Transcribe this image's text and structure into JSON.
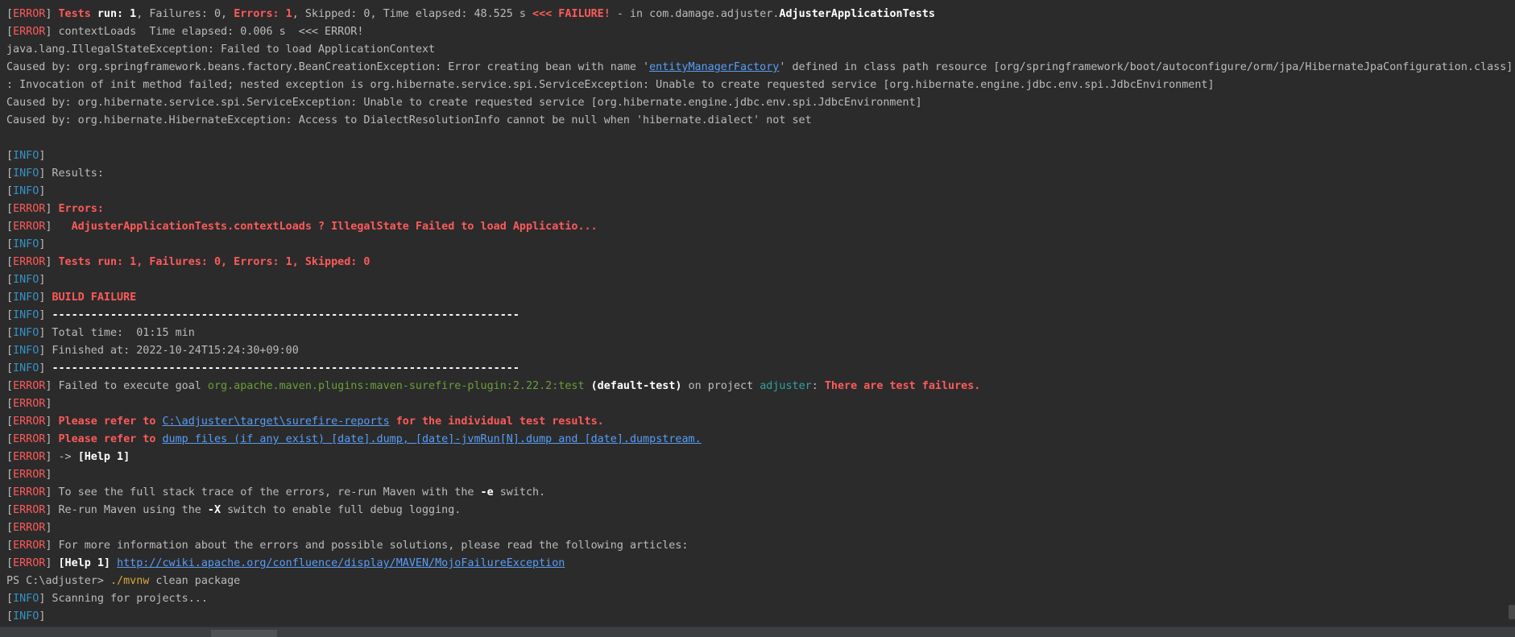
{
  "terminal": {
    "lines": [
      {
        "segments": [
          {
            "t": "[",
            "c": "default"
          },
          {
            "t": "ERROR",
            "c": "error"
          },
          {
            "t": "] ",
            "c": "default"
          },
          {
            "t": "Tests ",
            "c": "error-b"
          },
          {
            "t": "run: 1",
            "c": "white-b"
          },
          {
            "t": ", Failures: 0, ",
            "c": "default"
          },
          {
            "t": "Errors: 1",
            "c": "error-b"
          },
          {
            "t": ", Skipped: 0, Time elapsed: 48.525 s ",
            "c": "default"
          },
          {
            "t": "<<< FAILURE!",
            "c": "error-b"
          },
          {
            "t": " - in com.damage.adjuster.",
            "c": "default"
          },
          {
            "t": "AdjusterApplicationTests",
            "c": "white-b"
          }
        ]
      },
      {
        "segments": [
          {
            "t": "[",
            "c": "default"
          },
          {
            "t": "ERROR",
            "c": "error"
          },
          {
            "t": "] contextLoads  Time elapsed: 0.006 s  <<< ERROR!",
            "c": "default"
          }
        ]
      },
      {
        "segments": [
          {
            "t": "java.lang.IllegalStateException: Failed to load ApplicationContext",
            "c": "default"
          }
        ]
      },
      {
        "segments": [
          {
            "t": "Caused by: org.springframework.beans.factory.BeanCreationException: Error creating bean with name '",
            "c": "default"
          },
          {
            "t": "entityManagerFactory",
            "c": "link"
          },
          {
            "t": "' defined in class path resource [org/springframework/boot/autoconfigure/orm/jpa/HibernateJpaConfiguration.class]",
            "c": "default"
          }
        ]
      },
      {
        "segments": [
          {
            "t": ": Invocation of init method failed; nested exception is org.hibernate.service.spi.ServiceException: Unable to create requested service [org.hibernate.engine.jdbc.env.spi.JdbcEnvironment]",
            "c": "default"
          }
        ]
      },
      {
        "segments": [
          {
            "t": "Caused by: org.hibernate.service.spi.ServiceException: Unable to create requested service [org.hibernate.engine.jdbc.env.spi.JdbcEnvironment]",
            "c": "default"
          }
        ]
      },
      {
        "segments": [
          {
            "t": "Caused by: org.hibernate.HibernateException: Access to DialectResolutionInfo cannot be null when 'hibernate.dialect' not set",
            "c": "default"
          }
        ]
      },
      {
        "segments": []
      },
      {
        "segments": [
          {
            "t": "[",
            "c": "default"
          },
          {
            "t": "INFO",
            "c": "info"
          },
          {
            "t": "]",
            "c": "default"
          }
        ]
      },
      {
        "segments": [
          {
            "t": "[",
            "c": "default"
          },
          {
            "t": "INFO",
            "c": "info"
          },
          {
            "t": "] Results:",
            "c": "default"
          }
        ]
      },
      {
        "segments": [
          {
            "t": "[",
            "c": "default"
          },
          {
            "t": "INFO",
            "c": "info"
          },
          {
            "t": "]",
            "c": "default"
          }
        ]
      },
      {
        "segments": [
          {
            "t": "[",
            "c": "default"
          },
          {
            "t": "ERROR",
            "c": "error"
          },
          {
            "t": "] ",
            "c": "default"
          },
          {
            "t": "Errors:",
            "c": "error-b"
          }
        ]
      },
      {
        "segments": [
          {
            "t": "[",
            "c": "default"
          },
          {
            "t": "ERROR",
            "c": "error"
          },
          {
            "t": "]   ",
            "c": "default"
          },
          {
            "t": "AdjusterApplicationTests.contextLoads ? IllegalState Failed to load Applicatio...",
            "c": "error-b"
          }
        ]
      },
      {
        "segments": [
          {
            "t": "[",
            "c": "default"
          },
          {
            "t": "INFO",
            "c": "info"
          },
          {
            "t": "]",
            "c": "default"
          }
        ]
      },
      {
        "segments": [
          {
            "t": "[",
            "c": "default"
          },
          {
            "t": "ERROR",
            "c": "error"
          },
          {
            "t": "] ",
            "c": "default"
          },
          {
            "t": "Tests run: 1, Failures: 0, Errors: 1, Skipped: 0",
            "c": "error-b"
          }
        ]
      },
      {
        "segments": [
          {
            "t": "[",
            "c": "default"
          },
          {
            "t": "INFO",
            "c": "info"
          },
          {
            "t": "]",
            "c": "default"
          }
        ]
      },
      {
        "segments": [
          {
            "t": "[",
            "c": "default"
          },
          {
            "t": "INFO",
            "c": "info"
          },
          {
            "t": "] ",
            "c": "default"
          },
          {
            "t": "BUILD FAILURE",
            "c": "error-b"
          }
        ]
      },
      {
        "segments": [
          {
            "t": "[",
            "c": "default"
          },
          {
            "t": "INFO",
            "c": "info"
          },
          {
            "t": "] ",
            "c": "default"
          },
          {
            "t": "------------------------------------------------------------------------",
            "c": "white-b"
          }
        ]
      },
      {
        "segments": [
          {
            "t": "[",
            "c": "default"
          },
          {
            "t": "INFO",
            "c": "info"
          },
          {
            "t": "] Total time:  01:15 min",
            "c": "default"
          }
        ]
      },
      {
        "segments": [
          {
            "t": "[",
            "c": "default"
          },
          {
            "t": "INFO",
            "c": "info"
          },
          {
            "t": "] Finished at: 2022-10-24T15:24:30+09:00",
            "c": "default"
          }
        ]
      },
      {
        "segments": [
          {
            "t": "[",
            "c": "default"
          },
          {
            "t": "INFO",
            "c": "info"
          },
          {
            "t": "] ",
            "c": "default"
          },
          {
            "t": "------------------------------------------------------------------------",
            "c": "white-b"
          }
        ]
      },
      {
        "segments": [
          {
            "t": "[",
            "c": "default"
          },
          {
            "t": "ERROR",
            "c": "error"
          },
          {
            "t": "] Failed to execute goal ",
            "c": "default"
          },
          {
            "t": "org.apache.maven.plugins:maven-surefire-plugin:2.22.2:test",
            "c": "green"
          },
          {
            "t": " ",
            "c": "default"
          },
          {
            "t": "(default-test)",
            "c": "white-b"
          },
          {
            "t": " on project ",
            "c": "default"
          },
          {
            "t": "adjuster",
            "c": "cyan"
          },
          {
            "t": ": ",
            "c": "default"
          },
          {
            "t": "There are test failures.",
            "c": "error-b"
          }
        ]
      },
      {
        "segments": [
          {
            "t": "[",
            "c": "default"
          },
          {
            "t": "ERROR",
            "c": "error"
          },
          {
            "t": "]",
            "c": "default"
          }
        ]
      },
      {
        "segments": [
          {
            "t": "[",
            "c": "default"
          },
          {
            "t": "ERROR",
            "c": "error"
          },
          {
            "t": "] ",
            "c": "default"
          },
          {
            "t": "Please refer to ",
            "c": "error-b"
          },
          {
            "t": "C:\\adjuster\\target\\surefire-reports",
            "c": "link"
          },
          {
            "t": " for the individual test results.",
            "c": "error-b"
          }
        ]
      },
      {
        "segments": [
          {
            "t": "[",
            "c": "default"
          },
          {
            "t": "ERROR",
            "c": "error"
          },
          {
            "t": "] ",
            "c": "default"
          },
          {
            "t": "Please refer to ",
            "c": "error-b"
          },
          {
            "t": "dump files (if any exist) [date].dump, [date]-jvmRun[N].dump and [date].dumpstream.",
            "c": "link"
          }
        ]
      },
      {
        "segments": [
          {
            "t": "[",
            "c": "default"
          },
          {
            "t": "ERROR",
            "c": "error"
          },
          {
            "t": "] -> ",
            "c": "default"
          },
          {
            "t": "[Help 1]",
            "c": "white-b"
          }
        ]
      },
      {
        "segments": [
          {
            "t": "[",
            "c": "default"
          },
          {
            "t": "ERROR",
            "c": "error"
          },
          {
            "t": "]",
            "c": "default"
          }
        ]
      },
      {
        "segments": [
          {
            "t": "[",
            "c": "default"
          },
          {
            "t": "ERROR",
            "c": "error"
          },
          {
            "t": "] To see the full stack trace of the errors, re-run Maven with the ",
            "c": "default"
          },
          {
            "t": "-e",
            "c": "white-b"
          },
          {
            "t": " switch.",
            "c": "default"
          }
        ]
      },
      {
        "segments": [
          {
            "t": "[",
            "c": "default"
          },
          {
            "t": "ERROR",
            "c": "error"
          },
          {
            "t": "] Re-run Maven using the ",
            "c": "default"
          },
          {
            "t": "-X",
            "c": "white-b"
          },
          {
            "t": " switch to enable full debug logging.",
            "c": "default"
          }
        ]
      },
      {
        "segments": [
          {
            "t": "[",
            "c": "default"
          },
          {
            "t": "ERROR",
            "c": "error"
          },
          {
            "t": "]",
            "c": "default"
          }
        ]
      },
      {
        "segments": [
          {
            "t": "[",
            "c": "default"
          },
          {
            "t": "ERROR",
            "c": "error"
          },
          {
            "t": "] For more information about the errors and possible solutions, please read the following articles:",
            "c": "default"
          }
        ]
      },
      {
        "segments": [
          {
            "t": "[",
            "c": "default"
          },
          {
            "t": "ERROR",
            "c": "error"
          },
          {
            "t": "] ",
            "c": "default"
          },
          {
            "t": "[Help 1]",
            "c": "white-b"
          },
          {
            "t": " ",
            "c": "default"
          },
          {
            "t": "http://cwiki.apache.org/confluence/display/MAVEN/MojoFailureException",
            "c": "link"
          }
        ]
      },
      {
        "segments": [
          {
            "t": "PS C:\\adjuster> ",
            "c": "default"
          },
          {
            "t": "./mvnw",
            "c": "yellow"
          },
          {
            "t": " clean package",
            "c": "default"
          }
        ]
      },
      {
        "segments": [
          {
            "t": "[",
            "c": "default"
          },
          {
            "t": "INFO",
            "c": "info"
          },
          {
            "t": "] Scanning for projects...",
            "c": "default"
          }
        ]
      },
      {
        "segments": [
          {
            "t": "[",
            "c": "default"
          },
          {
            "t": "INFO",
            "c": "info"
          },
          {
            "t": "]",
            "c": "default"
          }
        ]
      }
    ]
  },
  "colors": {
    "background": "#2b2b2b",
    "default_text": "#bbbbbb",
    "error": "#ff5a5a",
    "info": "#3592c4",
    "link": "#589df6",
    "green": "#6a9f3a",
    "cyan": "#2fa3a3",
    "yellow": "#d6a93a"
  }
}
